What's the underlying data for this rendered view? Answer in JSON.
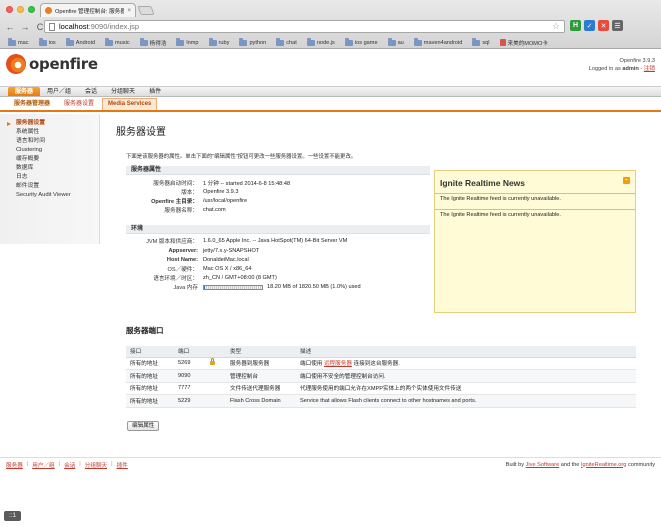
{
  "browser": {
    "tab_title": "Openfire 管理控制台: 服务器设置",
    "tab_close": "×",
    "back": "←",
    "forward": "→",
    "reload": "C",
    "url_host": "localhost",
    "url_path": ":9090/index.jsp",
    "bookmarks": [
      "mac",
      "ios",
      "Android",
      "music",
      "杨得浩",
      "lnmp",
      "ruby",
      "python",
      "chat",
      "node.js",
      "ios game",
      "au",
      "maven4android",
      "sql",
      "来美的MOMO卡"
    ],
    "extensions": [
      "H",
      "✓",
      "✕",
      "☰"
    ],
    "extension_colors": [
      "#2d9c3b",
      "#2d7bd1",
      "#e74c3c",
      "#666666"
    ]
  },
  "header": {
    "logo_text": "openfire",
    "version": "Openfire 3.9.3",
    "login_prefix": "Logged in as ",
    "user": "admin",
    "logout_sep": " - ",
    "logout": "注销"
  },
  "main_nav": [
    "服务器",
    "用户／组",
    "会话",
    "分组聊天",
    "插件"
  ],
  "sub_nav": [
    "服务器管理器",
    "服务器设置",
    "Media Services"
  ],
  "sidebar": [
    "服务器设置",
    "系统属性",
    "语言和时间",
    "Clustering",
    "缓存概要",
    "数据库",
    "日志",
    "邮件设置",
    "Security Audit Viewer"
  ],
  "page": {
    "title": "服务器设置",
    "intro": "下面是该服务器的属性。单击下面的\"编辑属性\"按钮可更改一些服务器设置。一些设置不能更改。"
  },
  "server_props": {
    "header": "服务器属性",
    "rows": [
      {
        "label": "服务器启动时间：",
        "value": "1 分钟 -- started 2014-6-8 15:48:48"
      },
      {
        "label": "版本：",
        "value": "Openfire 3.9.3"
      },
      {
        "label": "Openfire 主目录：",
        "value": "/usr/local/openfire"
      },
      {
        "label": "服务器名称：",
        "value": "chat.com"
      }
    ]
  },
  "env": {
    "header": "环境",
    "rows": [
      {
        "label": "JVM 版本和供应商：",
        "value": "1.6.0_65 Apple Inc. -- Java HotSpot(TM) 64-Bit Server VM"
      },
      {
        "label": "Appserver:",
        "value": "jetty/7.x.y-SNAPSHOT"
      },
      {
        "label": "Host Name:",
        "value": "DonaldeiMac.local"
      },
      {
        "label": "OS／硬件：",
        "value": "Mac OS X / x86_64"
      },
      {
        "label": "语言环境／时区：",
        "value": "zh_CN / GMT+08:00 (8 GMT)"
      },
      {
        "label": "Java 内存",
        "value": "18.20 MB of 1820.50 MB (1.0%) used"
      }
    ],
    "memory_used_fraction": 0.01
  },
  "news": {
    "title": "Ignite Realtime News",
    "rss_icon": "⌁",
    "items": [
      "The Ignite Realtime feed is currently unavailable.",
      "The Ignite Realtime feed is currently unavailable."
    ]
  },
  "ports": {
    "title": "服务器端口",
    "columns": [
      "接口",
      "端口",
      "",
      "类型",
      "描述"
    ],
    "rows": [
      {
        "iface": "所有的地址",
        "port": "5269",
        "secure": true,
        "type": "服务器到服务器",
        "desc_pre": "端口使用 ",
        "desc_link": "远程服务器",
        "desc_post": " 连接到这台服务器."
      },
      {
        "iface": "所有的地址",
        "port": "9090",
        "secure": false,
        "type": "管理控制台",
        "desc_pre": "端口使用不安全的管理控制台访问.",
        "desc_link": "",
        "desc_post": ""
      },
      {
        "iface": "所有的地址",
        "port": "7777",
        "secure": false,
        "type": "文件传送代理服务器",
        "desc_pre": "代理服务使用的端口允许在XMPP实体上的两个实体使用文件传送",
        "desc_link": "",
        "desc_post": ""
      },
      {
        "iface": "所有的地址",
        "port": "5229",
        "secure": false,
        "type": "Flash Cross Domain",
        "desc_pre": "Service that allows Flash clients connect to other hostnames and ports.",
        "desc_link": "",
        "desc_post": ""
      }
    ]
  },
  "edit_button": "编辑属性",
  "footer": {
    "links": [
      "服务器",
      "用户／组",
      "会话",
      "分组聊天",
      "插件"
    ],
    "credit_pre": "Built by ",
    "credit_link1": "Jive Software",
    "credit_mid": " and the ",
    "credit_link2": "IgniteRealtime.org",
    "credit_post": " community"
  },
  "status_chip": "::1"
}
